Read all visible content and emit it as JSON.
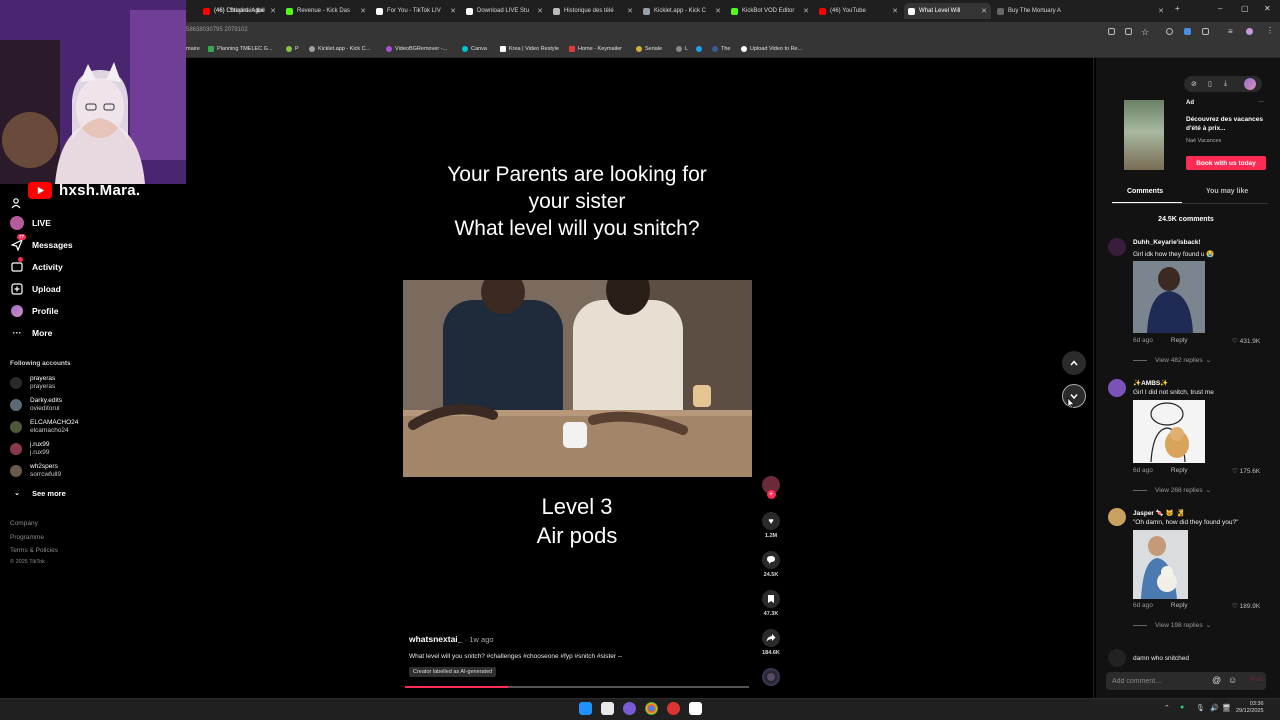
{
  "browser": {
    "tabs": [
      {
        "label": "(46) I Stayed in the",
        "color": "#ff0000"
      },
      {
        "label": "(46) Christina Aguil",
        "color": "#ff0000"
      },
      {
        "label": "Revenue - Kick Das",
        "color": "#53fc18"
      },
      {
        "label": "For You - TikTok LIV",
        "color": "#ffffff"
      },
      {
        "label": "Download LIVE Stu",
        "color": "#ffffff"
      },
      {
        "label": "Historique des télé",
        "color": "#bbbbbb"
      },
      {
        "label": "Kicklet.app - Kick C",
        "color": "#9aa0a6"
      },
      {
        "label": "KickBot VOD Editor",
        "color": "#53fc18"
      },
      {
        "label": "(46) YouTube",
        "color": "#ff0000"
      },
      {
        "label": "What Level Will",
        "color": "#ffffff"
      },
      {
        "label": "Buy The Mortuary A",
        "color": "#666666"
      }
    ],
    "url_fragment": "58638030795 2078102",
    "bookmarks": [
      "maire",
      "Planning TMELEC G...",
      "P",
      "Kicklet.app - Kick C...",
      "VideoBGRemover -...",
      "Canva",
      "Krea | Video Restyle",
      "Home - Keymailer",
      "Seriale",
      "L",
      "The",
      "Upload Video to Re..."
    ]
  },
  "overlay": {
    "streamer_name": "hxsh.Mara."
  },
  "sidebar": {
    "nav": [
      {
        "label": "LIVE",
        "icon": "live-icon"
      },
      {
        "label": "Messages",
        "icon": "messages-icon",
        "badge": "77"
      },
      {
        "label": "Activity",
        "icon": "activity-icon"
      },
      {
        "label": "Upload",
        "icon": "upload-icon"
      },
      {
        "label": "Profile",
        "icon": "profile-icon"
      },
      {
        "label": "More",
        "icon": "more-icon"
      }
    ],
    "following_header": "Following accounts",
    "accounts": [
      {
        "name": "prayeras",
        "handle": "prayeras"
      },
      {
        "name": "Darky.edits",
        "handle": "ovieditorul"
      },
      {
        "name": "ELCAMACHO24",
        "handle": "elcamacho24"
      },
      {
        "name": "j.rux99",
        "handle": "j.rux99"
      },
      {
        "name": "wh2spers",
        "handle": "sorrcwfull9"
      }
    ],
    "see_more": "See more",
    "footer": [
      "Company",
      "Programme",
      "Terms & Policies",
      "© 2025 TikTok"
    ]
  },
  "video": {
    "title_lines": [
      "Your Parents are looking for",
      "your sister",
      "What level will you snitch?"
    ],
    "level_line1": "Level 3",
    "level_line2": "Air pods",
    "author": "whatsnextai_",
    "posted": "· 1w ago",
    "caption": "What level will you snitch? #challenges #chooseone #fyp #snitch #sister --",
    "ai_label": "Creator labelled as AI-generated",
    "progress": 0.3,
    "actions": {
      "likes": "1.2M",
      "comments": "24.5K",
      "saves": "47.3K",
      "shares": "184.6K"
    }
  },
  "ad": {
    "label": "Ad",
    "title": "Découvrez des vacances d'été à prix...",
    "brand": "Naé Vacances",
    "cta": "Book with us today"
  },
  "panel": {
    "tabs": [
      "Comments",
      "You may like"
    ],
    "comment_count": "24.5K comments",
    "comments": [
      {
        "user": "Duhh_Keyarie'isback!",
        "text": "Girl idk how they found u 😭",
        "age": "6d ago",
        "reply": "Reply",
        "likes": "431.9K",
        "replies": "View 482 replies",
        "avatar": "#3a1d3a"
      },
      {
        "user": "✨AMBS✨",
        "text": "Girl I did not snitch, trust me",
        "age": "6d ago",
        "reply": "Reply",
        "likes": "175.6K",
        "replies": "View 268 replies",
        "avatar": "#7b52b5"
      },
      {
        "user": "Jasper 🍬 🐱 🧏",
        "text": "\"Oh damn, how did they found you?\"",
        "age": "6d ago",
        "reply": "Reply",
        "likes": "189.9K",
        "replies": "View 198 replies",
        "avatar": "#c8a060"
      },
      {
        "user": "",
        "text": "damn who snitched"
      }
    ],
    "add_comment_placeholder": "Add comment...",
    "post": "Post"
  },
  "taskbar": {
    "time": "03:36",
    "date": "29/12/2025"
  }
}
